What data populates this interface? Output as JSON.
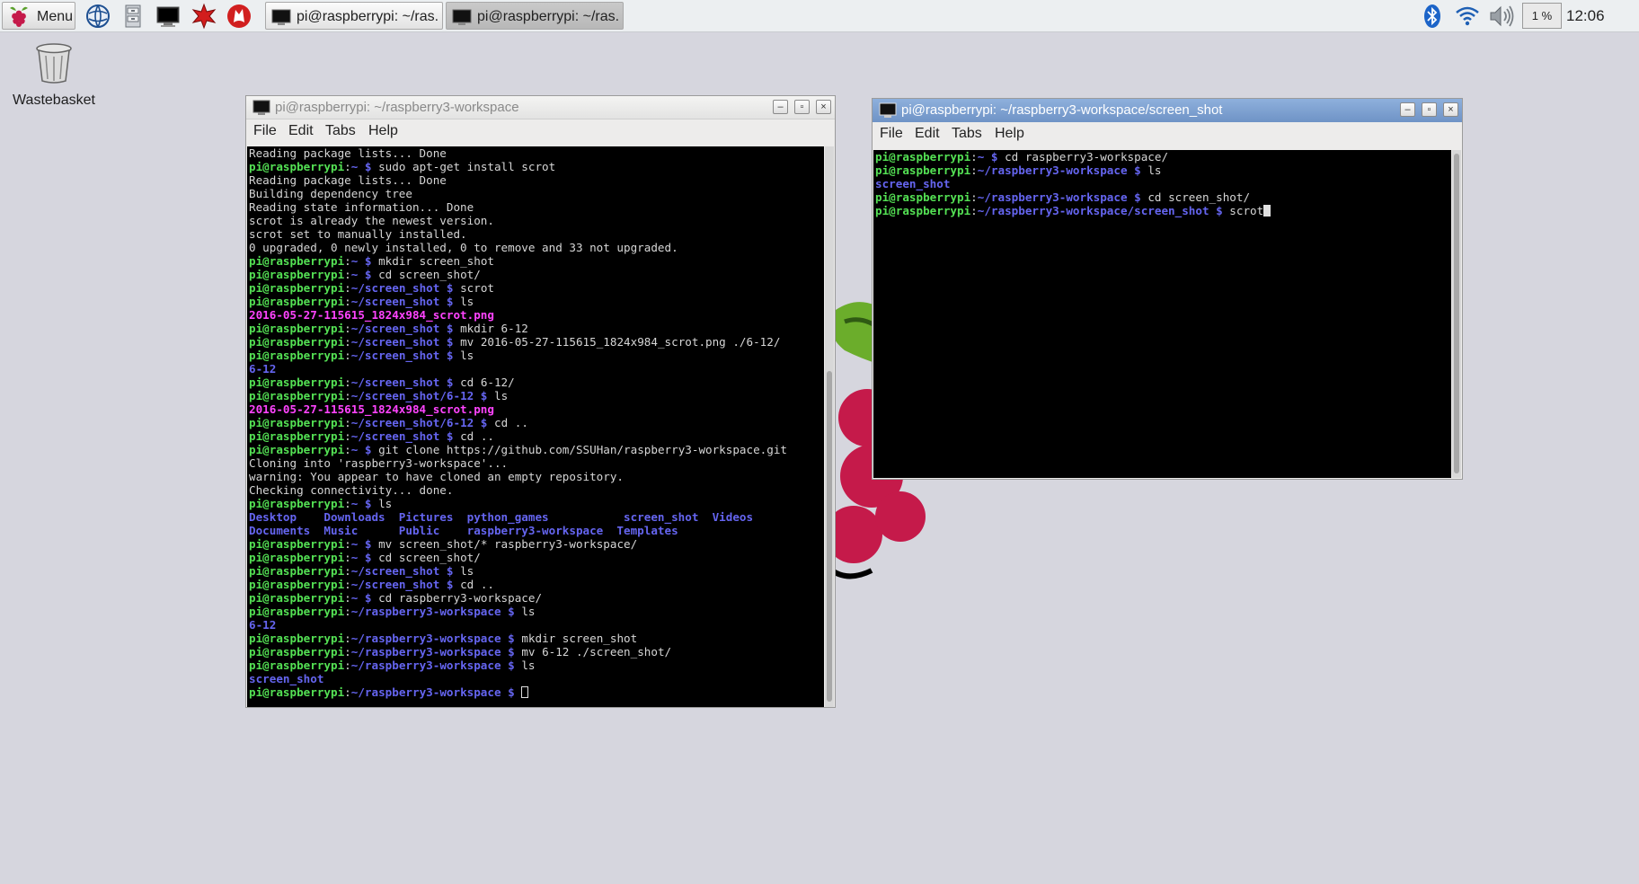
{
  "taskbar": {
    "menu_label": "Menu",
    "tasks": [
      {
        "label": "pi@raspberrypi: ~/ras...",
        "active": false
      },
      {
        "label": "pi@raspberrypi: ~/ras...",
        "active": true
      }
    ],
    "cpu": "1 %",
    "clock": "12:06"
  },
  "desktop": {
    "icons": [
      {
        "label": "Wastebasket",
        "icon": "trash-icon"
      }
    ]
  },
  "windows": [
    {
      "id": "left",
      "title": "pi@raspberrypi: ~/raspberry3-workspace",
      "active": false,
      "menu": [
        "File",
        "Edit",
        "Tabs",
        "Help"
      ],
      "lines": [
        [
          [
            "w",
            "Reading package lists... Done"
          ]
        ],
        [
          [
            "g",
            "pi@raspberrypi"
          ],
          [
            "w",
            ":"
          ],
          [
            "b",
            "~ $"
          ],
          [
            "w",
            " sudo apt-get install scrot"
          ]
        ],
        [
          [
            "w",
            "Reading package lists... Done"
          ]
        ],
        [
          [
            "w",
            "Building dependency tree"
          ]
        ],
        [
          [
            "w",
            "Reading state information... Done"
          ]
        ],
        [
          [
            "w",
            "scrot is already the newest version."
          ]
        ],
        [
          [
            "w",
            "scrot set to manually installed."
          ]
        ],
        [
          [
            "w",
            "0 upgraded, 0 newly installed, 0 to remove and 33 not upgraded."
          ]
        ],
        [
          [
            "g",
            "pi@raspberrypi"
          ],
          [
            "w",
            ":"
          ],
          [
            "b",
            "~ $"
          ],
          [
            "w",
            " mkdir screen_shot"
          ]
        ],
        [
          [
            "g",
            "pi@raspberrypi"
          ],
          [
            "w",
            ":"
          ],
          [
            "b",
            "~ $"
          ],
          [
            "w",
            " cd screen_shot/"
          ]
        ],
        [
          [
            "g",
            "pi@raspberrypi"
          ],
          [
            "w",
            ":"
          ],
          [
            "b",
            "~/screen_shot $"
          ],
          [
            "w",
            " scrot"
          ]
        ],
        [
          [
            "g",
            "pi@raspberrypi"
          ],
          [
            "w",
            ":"
          ],
          [
            "b",
            "~/screen_shot $"
          ],
          [
            "w",
            " ls"
          ]
        ],
        [
          [
            "m",
            "2016-05-27-115615_1824x984_scrot.png"
          ]
        ],
        [
          [
            "g",
            "pi@raspberrypi"
          ],
          [
            "w",
            ":"
          ],
          [
            "b",
            "~/screen_shot $"
          ],
          [
            "w",
            " mkdir 6-12"
          ]
        ],
        [
          [
            "g",
            "pi@raspberrypi"
          ],
          [
            "w",
            ":"
          ],
          [
            "b",
            "~/screen_shot $"
          ],
          [
            "w",
            " mv 2016-05-27-115615_1824x984_scrot.png ./6-12/"
          ]
        ],
        [
          [
            "g",
            "pi@raspberrypi"
          ],
          [
            "w",
            ":"
          ],
          [
            "b",
            "~/screen_shot $"
          ],
          [
            "w",
            " ls"
          ]
        ],
        [
          [
            "b",
            "6-12"
          ]
        ],
        [
          [
            "g",
            "pi@raspberrypi"
          ],
          [
            "w",
            ":"
          ],
          [
            "b",
            "~/screen_shot $"
          ],
          [
            "w",
            " cd 6-12/"
          ]
        ],
        [
          [
            "g",
            "pi@raspberrypi"
          ],
          [
            "w",
            ":"
          ],
          [
            "b",
            "~/screen_shot/6-12 $"
          ],
          [
            "w",
            " ls"
          ]
        ],
        [
          [
            "m",
            "2016-05-27-115615_1824x984_scrot.png"
          ]
        ],
        [
          [
            "g",
            "pi@raspberrypi"
          ],
          [
            "w",
            ":"
          ],
          [
            "b",
            "~/screen_shot/6-12 $"
          ],
          [
            "w",
            " cd .."
          ]
        ],
        [
          [
            "g",
            "pi@raspberrypi"
          ],
          [
            "w",
            ":"
          ],
          [
            "b",
            "~/screen_shot $"
          ],
          [
            "w",
            " cd .."
          ]
        ],
        [
          [
            "g",
            "pi@raspberrypi"
          ],
          [
            "w",
            ":"
          ],
          [
            "b",
            "~ $"
          ],
          [
            "w",
            " git clone https://github.com/SSUHan/raspberry3-workspace.git"
          ]
        ],
        [
          [
            "w",
            "Cloning into 'raspberry3-workspace'..."
          ]
        ],
        [
          [
            "w",
            "warning: You appear to have cloned an empty repository."
          ]
        ],
        [
          [
            "w",
            "Checking connectivity... done."
          ]
        ],
        [
          [
            "g",
            "pi@raspberrypi"
          ],
          [
            "w",
            ":"
          ],
          [
            "b",
            "~ $"
          ],
          [
            "w",
            " ls"
          ]
        ],
        [
          [
            "b",
            "Desktop    Downloads  Pictures  python_games           screen_shot  Videos"
          ]
        ],
        [
          [
            "b",
            "Documents  Music      Public    raspberry3-workspace  Templates"
          ]
        ],
        [
          [
            "g",
            "pi@raspberrypi"
          ],
          [
            "w",
            ":"
          ],
          [
            "b",
            "~ $"
          ],
          [
            "w",
            " mv screen_shot/* raspberry3-workspace/"
          ]
        ],
        [
          [
            "g",
            "pi@raspberrypi"
          ],
          [
            "w",
            ":"
          ],
          [
            "b",
            "~ $"
          ],
          [
            "w",
            " cd screen_shot/"
          ]
        ],
        [
          [
            "g",
            "pi@raspberrypi"
          ],
          [
            "w",
            ":"
          ],
          [
            "b",
            "~/screen_shot $"
          ],
          [
            "w",
            " ls"
          ]
        ],
        [
          [
            "g",
            "pi@raspberrypi"
          ],
          [
            "w",
            ":"
          ],
          [
            "b",
            "~/screen_shot $"
          ],
          [
            "w",
            " cd .."
          ]
        ],
        [
          [
            "g",
            "pi@raspberrypi"
          ],
          [
            "w",
            ":"
          ],
          [
            "b",
            "~ $"
          ],
          [
            "w",
            " cd raspberry3-workspace/"
          ]
        ],
        [
          [
            "g",
            "pi@raspberrypi"
          ],
          [
            "w",
            ":"
          ],
          [
            "b",
            "~/raspberry3-workspace $"
          ],
          [
            "w",
            " ls"
          ]
        ],
        [
          [
            "b",
            "6-12"
          ]
        ],
        [
          [
            "g",
            "pi@raspberrypi"
          ],
          [
            "w",
            ":"
          ],
          [
            "b",
            "~/raspberry3-workspace $"
          ],
          [
            "w",
            " mkdir screen_shot"
          ]
        ],
        [
          [
            "g",
            "pi@raspberrypi"
          ],
          [
            "w",
            ":"
          ],
          [
            "b",
            "~/raspberry3-workspace $"
          ],
          [
            "w",
            " mv 6-12 ./screen_shot/"
          ]
        ],
        [
          [
            "g",
            "pi@raspberrypi"
          ],
          [
            "w",
            ":"
          ],
          [
            "b",
            "~/raspberry3-workspace $"
          ],
          [
            "w",
            " ls"
          ]
        ],
        [
          [
            "b",
            "screen_shot"
          ]
        ],
        [
          [
            "g",
            "pi@raspberrypi"
          ],
          [
            "w",
            ":"
          ],
          [
            "b",
            "~/raspberry3-workspace $"
          ],
          [
            "w",
            " "
          ],
          [
            "cursor",
            "outline"
          ]
        ]
      ]
    },
    {
      "id": "right",
      "title": "pi@raspberrypi: ~/raspberry3-workspace/screen_shot",
      "active": true,
      "menu": [
        "File",
        "Edit",
        "Tabs",
        "Help"
      ],
      "lines": [
        [
          [
            "g",
            "pi@raspberrypi"
          ],
          [
            "w",
            ":"
          ],
          [
            "b",
            "~ $"
          ],
          [
            "w",
            " cd raspberry3-workspace/"
          ]
        ],
        [
          [
            "g",
            "pi@raspberrypi"
          ],
          [
            "w",
            ":"
          ],
          [
            "b",
            "~/raspberry3-workspace $"
          ],
          [
            "w",
            " ls"
          ]
        ],
        [
          [
            "b",
            "screen_shot"
          ]
        ],
        [
          [
            "g",
            "pi@raspberrypi"
          ],
          [
            "w",
            ":"
          ],
          [
            "b",
            "~/raspberry3-workspace $"
          ],
          [
            "w",
            " cd screen_shot/"
          ]
        ],
        [
          [
            "g",
            "pi@raspberrypi"
          ],
          [
            "w",
            ":"
          ],
          [
            "b",
            "~/raspberry3-workspace/screen_shot $"
          ],
          [
            "w",
            " scrot"
          ],
          [
            "cursor",
            "solid"
          ]
        ]
      ]
    }
  ],
  "colors": {
    "desktop_bg": "#d6d6de",
    "prompt_user": "#54e154",
    "prompt_path": "#6565f0",
    "image_file": "#ff44ff",
    "active_title": "#7a9cd0"
  }
}
